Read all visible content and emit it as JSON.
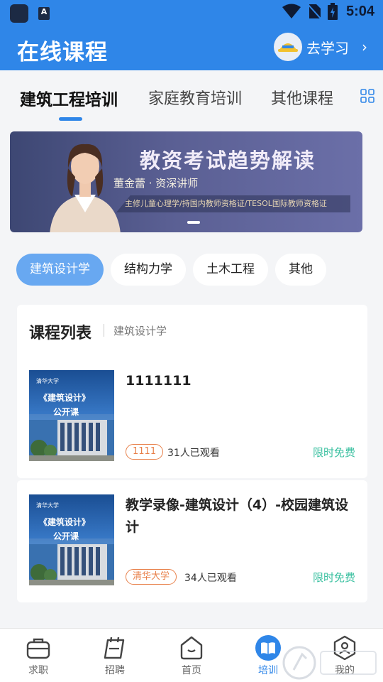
{
  "status_bar": {
    "time": "5:04",
    "a_badge": "A"
  },
  "header": {
    "title": "在线课程",
    "goto_label": "去学习"
  },
  "tabs": [
    {
      "label": "建筑工程培训",
      "active": true
    },
    {
      "label": "家庭教育培训",
      "active": false
    },
    {
      "label": "其他课程",
      "active": false
    }
  ],
  "banner": {
    "title": "教资考试趋势解读",
    "name": "董金蕾 · 资深讲师",
    "quals": "主修儿童心理学/持国内教师资格证/TESOL国际教师资格证"
  },
  "chips": [
    {
      "label": "建筑设计学",
      "active": true
    },
    {
      "label": "结构力学",
      "active": false
    },
    {
      "label": "土木工程",
      "active": false
    },
    {
      "label": "其他",
      "active": false
    }
  ],
  "course_list": {
    "title": "课程列表",
    "subtitle": "建筑设计学",
    "items": [
      {
        "title": "1111111",
        "tag": "1111",
        "views": "31人已观看",
        "price": "限时免费",
        "thumb": {
          "line1": "清华大学",
          "line2": "《建筑设计》",
          "line3": "公开课"
        }
      },
      {
        "title": "教学录像-建筑设计（4）-校园建筑设计",
        "tag": "清华大学",
        "views": "34人已观看",
        "price": "限时免费",
        "thumb": {
          "line1": "清华大学",
          "line2": "《建筑设计》",
          "line3": "公开课"
        }
      }
    ]
  },
  "bottom_nav": [
    {
      "label": "求职",
      "icon": "briefcase-icon",
      "active": false
    },
    {
      "label": "招聘",
      "icon": "notepad-icon",
      "active": false
    },
    {
      "label": "首页",
      "icon": "home-icon",
      "active": false
    },
    {
      "label": "培训",
      "icon": "book-icon",
      "active": true
    },
    {
      "label": "我的",
      "icon": "profile-icon",
      "active": false
    }
  ],
  "colors": {
    "primary": "#2f86e8",
    "chip_active": "#68a8f1",
    "free": "#3ac0a0",
    "tag": "#e8804a"
  }
}
